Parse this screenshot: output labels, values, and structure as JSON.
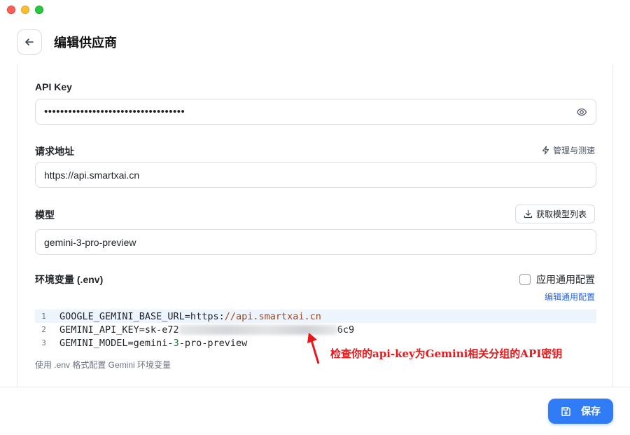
{
  "header": {
    "title": "编辑供应商"
  },
  "api_key": {
    "label": "API Key",
    "masked_value": "•••••••••••••••••••••••••••••••••••"
  },
  "endpoint": {
    "label": "请求地址",
    "action_label": "管理与测速",
    "value": "https://api.smartxai.cn"
  },
  "model": {
    "label": "模型",
    "fetch_label": "获取模型列表",
    "value": "gemini-3-pro-preview"
  },
  "env": {
    "label": "环境变量 (.env)",
    "checkbox_label": "应用通用配置",
    "edit_link": "编辑通用配置",
    "lines": [
      {
        "num": "1",
        "key": "GOOGLE_GEMINI_BASE_URL=https:",
        "url": "//api.smartxai.cn"
      },
      {
        "num": "2",
        "key": "GEMINI_API_KEY=sk-e72",
        "tail": "6c9"
      },
      {
        "num": "3",
        "pre": "GEMINI_MODEL=gemini-",
        "mid": "3",
        "post": "-pro-preview"
      }
    ],
    "hint": "使用 .env 格式配置 Gemini 环境变量"
  },
  "annotation": {
    "text": "检查你的api-key为Gemini相关分组的API密钥",
    "color": "#e8171a"
  },
  "footer": {
    "save_label": "保存",
    "accent": "#2f7cf6"
  }
}
